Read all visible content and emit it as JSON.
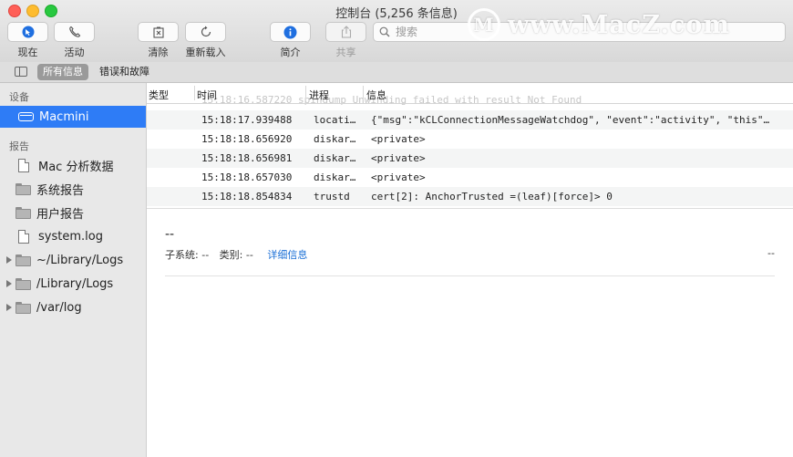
{
  "window": {
    "title": "控制台 (5,256 条信息)"
  },
  "toolbar": {
    "now": "现在",
    "activity": "活动",
    "clear": "清除",
    "reload": "重新载入",
    "info": "简介",
    "share": "共享",
    "search_placeholder": "搜索"
  },
  "watermark": {
    "text": "www.MacZ.com",
    "logo_letter": "M"
  },
  "filter": {
    "all": "所有信息",
    "errors": "错误和故障"
  },
  "sidebar": {
    "devices_header": "设备",
    "device": "Macmini",
    "reports_header": "报告",
    "items": [
      "Mac 分析数据",
      "系统报告",
      "用户报告",
      "system.log",
      "~/Library/Logs",
      "/Library/Logs",
      "/var/log"
    ]
  },
  "table": {
    "columns": [
      "类型",
      "时间",
      "进程",
      "信息"
    ],
    "ghost_text": "15:18:16.587220    spindump  Unwinding failed with result Not Found",
    "rows": [
      {
        "time": "15:18:17.939488",
        "process": "locati…",
        "message": "{\"msg\":\"kCLConnectionMessageWatchdog\", \"event\":\"activity\", \"this\"…"
      },
      {
        "time": "15:18:18.656920",
        "process": "diskar…",
        "message": "<private>"
      },
      {
        "time": "15:18:18.656981",
        "process": "diskar…",
        "message": "<private>"
      },
      {
        "time": "15:18:18.657030",
        "process": "diskar…",
        "message": "<private>"
      },
      {
        "time": "15:18:18.854834",
        "process": "trustd",
        "message": "cert[2]: AnchorTrusted =(leaf)[force]> 0"
      }
    ]
  },
  "detail": {
    "dash": "--",
    "subsystem_label": "子系统:",
    "subsystem_value": "--",
    "category_label": "类别:",
    "category_value": "--",
    "details_link": "详细信息",
    "right_value": "--"
  },
  "colors": {
    "selection": "#2e7cf6",
    "link": "#1a6fd6",
    "info_icon": "#1f6fe0"
  }
}
